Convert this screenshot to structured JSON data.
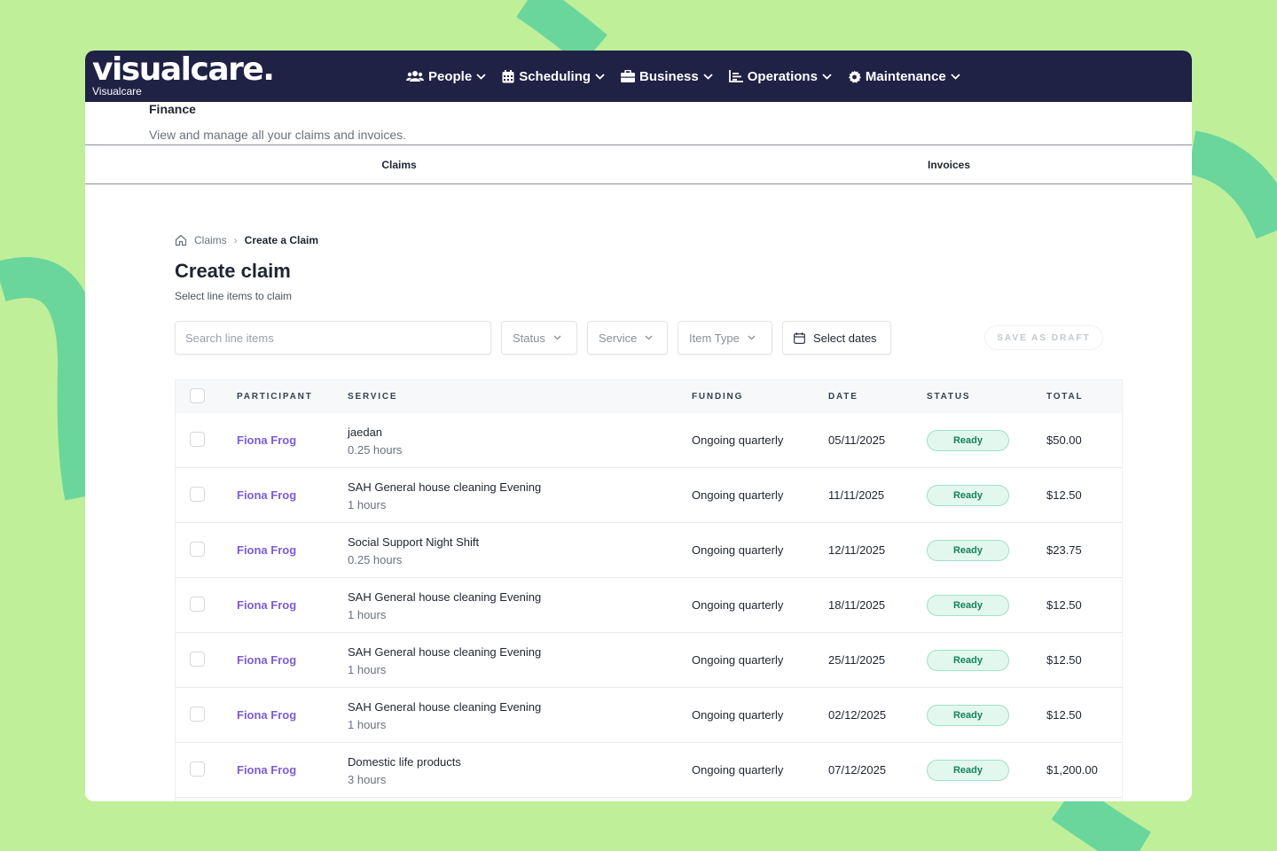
{
  "brand": {
    "logo": "visualcare.",
    "name": "Visualcare"
  },
  "nav": [
    {
      "label": "People",
      "icon": "users-icon"
    },
    {
      "label": "Scheduling",
      "icon": "calendar-icon"
    },
    {
      "label": "Business",
      "icon": "briefcase-icon"
    },
    {
      "label": "Operations",
      "icon": "chart-icon"
    },
    {
      "label": "Maintenance",
      "icon": "gear-icon"
    }
  ],
  "finance": {
    "title": "Finance",
    "description": "View and manage all your claims and invoices."
  },
  "tabs": [
    "Claims",
    "Invoices"
  ],
  "breadcrumb": {
    "parent": "Claims",
    "current": "Create a Claim"
  },
  "page": {
    "title": "Create claim",
    "subtitle": "Select line items to claim"
  },
  "filters": {
    "search_placeholder": "Search line items",
    "status": "Status",
    "service": "Service",
    "item_type": "Item Type",
    "dates": "Select dates",
    "save_draft": "SAVE AS DRAFT"
  },
  "table": {
    "columns": [
      "PARTICIPANT",
      "SERVICE",
      "FUNDING",
      "DATE",
      "STATUS",
      "TOTAL"
    ],
    "rows": [
      {
        "participant": "Fiona Frog",
        "service": "jaedan",
        "hours": "0.25 hours",
        "funding": "Ongoing quarterly",
        "date": "05/11/2025",
        "status": "Ready",
        "total": "$50.00"
      },
      {
        "participant": "Fiona Frog",
        "service": "SAH General house cleaning Evening",
        "hours": "1 hours",
        "funding": "Ongoing quarterly",
        "date": "11/11/2025",
        "status": "Ready",
        "total": "$12.50"
      },
      {
        "participant": "Fiona Frog",
        "service": "Social Support Night Shift",
        "hours": "0.25 hours",
        "funding": "Ongoing quarterly",
        "date": "12/11/2025",
        "status": "Ready",
        "total": "$23.75"
      },
      {
        "participant": "Fiona Frog",
        "service": "SAH General house cleaning Evening",
        "hours": "1 hours",
        "funding": "Ongoing quarterly",
        "date": "18/11/2025",
        "status": "Ready",
        "total": "$12.50"
      },
      {
        "participant": "Fiona Frog",
        "service": "SAH General house cleaning Evening",
        "hours": "1 hours",
        "funding": "Ongoing quarterly",
        "date": "25/11/2025",
        "status": "Ready",
        "total": "$12.50"
      },
      {
        "participant": "Fiona Frog",
        "service": "SAH General house cleaning Evening",
        "hours": "1 hours",
        "funding": "Ongoing quarterly",
        "date": "02/12/2025",
        "status": "Ready",
        "total": "$12.50"
      },
      {
        "participant": "Fiona Frog",
        "service": "Domestic life products",
        "hours": "3 hours",
        "funding": "Ongoing quarterly",
        "date": "07/12/2025",
        "status": "Ready",
        "total": "$1,200.00"
      }
    ]
  },
  "colors": {
    "background": "#c0ef9a",
    "swoosh": "#6ad69c",
    "navbar": "#1f2145",
    "participant_link": "#7c5cd4",
    "status_ready": "#17805c"
  }
}
